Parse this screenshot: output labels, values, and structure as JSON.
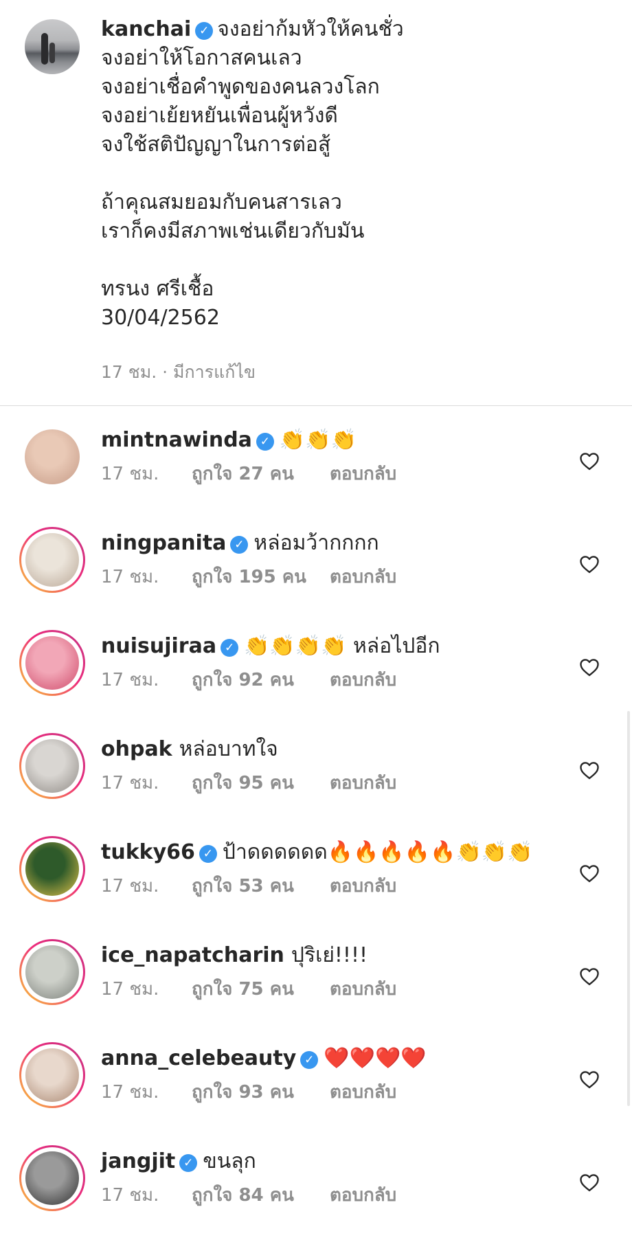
{
  "caption": {
    "username": "kanchai",
    "verified": true,
    "lines": [
      "จงอย่าก้มหัวให้คนชั่ว",
      "จงอย่าให้โอกาสคนเลว",
      "จงอย่าเชื่อคำพูดของคนลวงโลก",
      "จงอย่าเย้ยหยันเพื่อนผู้หวังดี",
      "จงใช้สติปัญญาในการต่อสู้",
      "",
      "ถ้าคุณสมยอมกับคนสารเลว",
      "เราก็คงมีสภาพเช่นเดียวกับมัน",
      "",
      "ทรนง ศรีเชื้อ",
      "30/04/2562"
    ],
    "meta": "17 ชม. · มีการแก้ไข"
  },
  "comments": [
    {
      "username": "mintnawinda",
      "verified": true,
      "text": "👏👏👏",
      "time": "17 ชม.",
      "likes": "ถูกใจ 27 คน",
      "reply": "ตอบกลับ",
      "has_story_ring": false,
      "avatar_colors": [
        "#e9c9b6",
        "#c59a86"
      ]
    },
    {
      "username": "ningpanita",
      "verified": true,
      "text": "หล่อมว้ากกกก",
      "time": "17 ชม.",
      "likes": "ถูกใจ 195 คน",
      "reply": "ตอบกลับ",
      "has_story_ring": true,
      "avatar_colors": [
        "#ebe4da",
        "#b9a796"
      ]
    },
    {
      "username": "nuisujiraa",
      "verified": true,
      "text": "👏👏👏👏 หล่อไปอีก",
      "time": "17 ชม.",
      "likes": "ถูกใจ 92 คน",
      "reply": "ตอบกลับ",
      "has_story_ring": true,
      "avatar_colors": [
        "#f2a7b7",
        "#cf4a6a"
      ]
    },
    {
      "username": "ohpak",
      "verified": false,
      "text": "หล่อบาทใจ",
      "time": "17 ชม.",
      "likes": "ถูกใจ 95 คน",
      "reply": "ตอบกลับ",
      "has_story_ring": true,
      "avatar_colors": [
        "#d9d6d2",
        "#8f8a85"
      ]
    },
    {
      "username": "tukky66",
      "verified": true,
      "text": "ป้าดดดดดด🔥🔥🔥🔥🔥👏👏👏",
      "time": "17 ชม.",
      "likes": "ถูกใจ 53 คน",
      "reply": "ตอบกลับ",
      "has_story_ring": true,
      "avatar_colors": [
        "#2e5a2a",
        "#e0c24a"
      ]
    },
    {
      "username": "ice_napatcharin",
      "verified": false,
      "text": "ปุริเย่!!!!",
      "time": "17 ชม.",
      "likes": "ถูกใจ 75 คน",
      "reply": "ตอบกลับ",
      "has_story_ring": true,
      "avatar_colors": [
        "#cdd0c9",
        "#7b7f79"
      ]
    },
    {
      "username": "anna_celebeauty",
      "verified": true,
      "text": "❤️❤️❤️❤️",
      "time": "17 ชม.",
      "likes": "ถูกใจ 93 คน",
      "reply": "ตอบกลับ",
      "has_story_ring": true,
      "avatar_colors": [
        "#e8d8cc",
        "#a98670"
      ]
    },
    {
      "username": "jangjit",
      "verified": true,
      "text": "ขนลุก",
      "time": "17 ชม.",
      "likes": "ถูกใจ 84 คน",
      "reply": "ตอบกลับ",
      "has_story_ring": true,
      "avatar_colors": [
        "#9a9a9a",
        "#2e2e2e"
      ]
    }
  ],
  "icons": {
    "verified": "verified-badge-icon",
    "like": "heart-outline-icon"
  },
  "colors": {
    "verified": "#3897f0",
    "meta_text": "#8e8e8e",
    "text": "#262626",
    "divider": "#dbdbdb"
  }
}
